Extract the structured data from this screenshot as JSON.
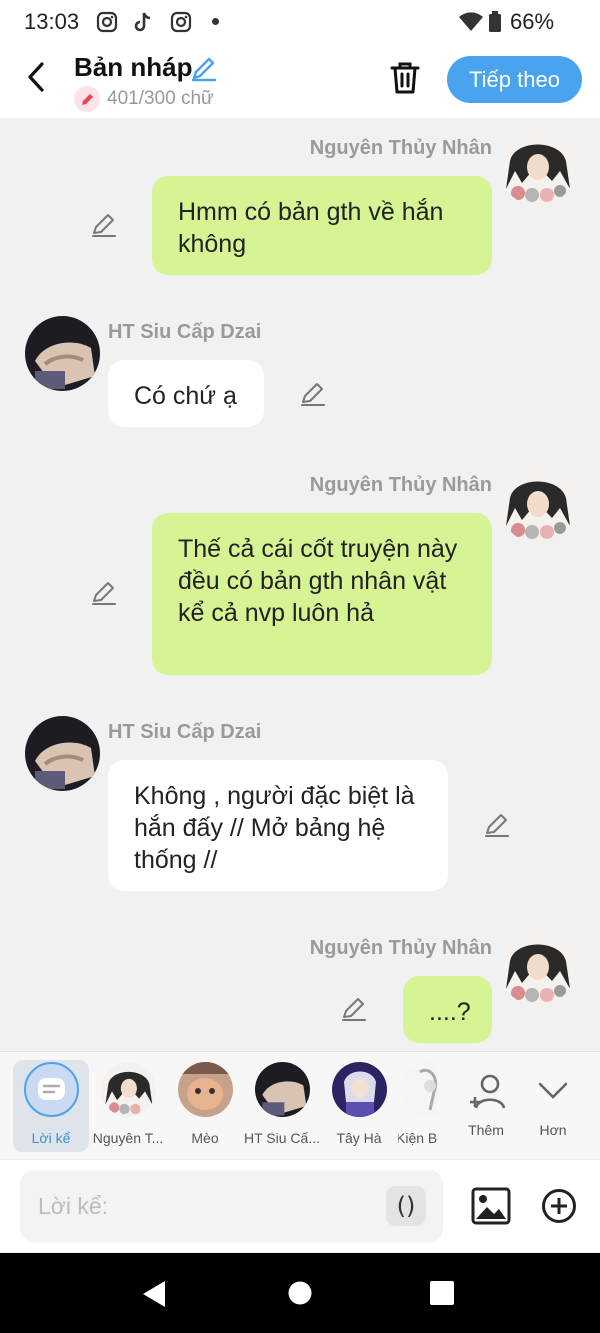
{
  "status_bar": {
    "time": "13:03",
    "battery": "66%"
  },
  "header": {
    "title": "Bản nháp",
    "count": "401/300 chữ",
    "next_label": "Tiếp theo"
  },
  "messages": [
    {
      "sender": "Nguyên Thủy Nhân",
      "text": "Hmm có bản gth về hắn không",
      "side": "right"
    },
    {
      "sender": "HT Siu Cấp Dzai",
      "text": "Có chứ ạ",
      "side": "left"
    },
    {
      "sender": "Nguyên Thủy Nhân",
      "text": "Thế cả cái cốt truyện này đều có bản gth nhân vật kể cả nvp luôn hả",
      "side": "right"
    },
    {
      "sender": "HT Siu Cấp Dzai",
      "text": "Không , người đặc biệt là hắn đấy // Mở bảng hệ thống //",
      "side": "left"
    },
    {
      "sender": "Nguyên Thủy Nhân",
      "text": "....?",
      "side": "right"
    }
  ],
  "characters": [
    {
      "label": "Lời kể"
    },
    {
      "label": "Nguyên T..."
    },
    {
      "label": "Mèo"
    },
    {
      "label": "HT Siu Cấ..."
    },
    {
      "label": "Tây Hà"
    },
    {
      "label": "Kiện B"
    }
  ],
  "actions": {
    "add_label": "Thêm",
    "more_label": "Hơn"
  },
  "input": {
    "placeholder": "Lời kể:",
    "paren_label": "()"
  },
  "colors": {
    "accent": "#4aa3ef",
    "bubble_green": "#d6f493",
    "background": "#f1f1f1"
  }
}
